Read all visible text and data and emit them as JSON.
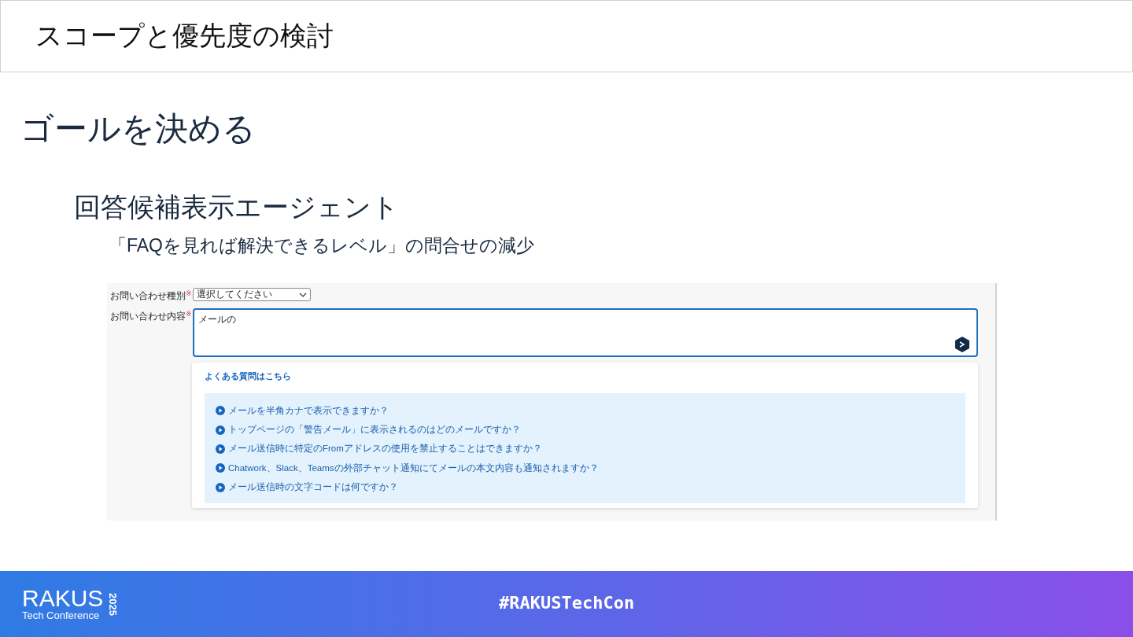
{
  "slide": {
    "title": "スコープと優先度の検討",
    "heading": "ゴールを決める",
    "subheading": "回答候補表示エージェント",
    "goal": "「FAQを見れば解決できるレベル」の問合せの減少"
  },
  "form": {
    "fields": [
      {
        "kind": "select",
        "label": "お問い合わせ種別",
        "required_mark": "※",
        "value": "選択してください"
      },
      {
        "kind": "textarea",
        "label": "お問い合わせ内容",
        "required_mark": "※",
        "value": "メールの"
      }
    ],
    "faq": {
      "title": "よくある質問はこちら",
      "items": [
        "メールを半角カナで表示できますか？",
        "トップページの「警告メール」に表示されるのはどのメールですか？",
        "メール送信時に特定のFromアドレスの使用を禁止することはできますか？",
        "Chatwork、Slack、Teamsの外部チャット通知にてメールの本文内容も通知されますか？",
        "メール送信時の文字コードは何ですか？"
      ]
    }
  },
  "footer": {
    "logo_text": "RAKUS",
    "logo_sub": "Tech Conference",
    "logo_year": "2025",
    "hashtag": "#RAKUSTechCon"
  }
}
